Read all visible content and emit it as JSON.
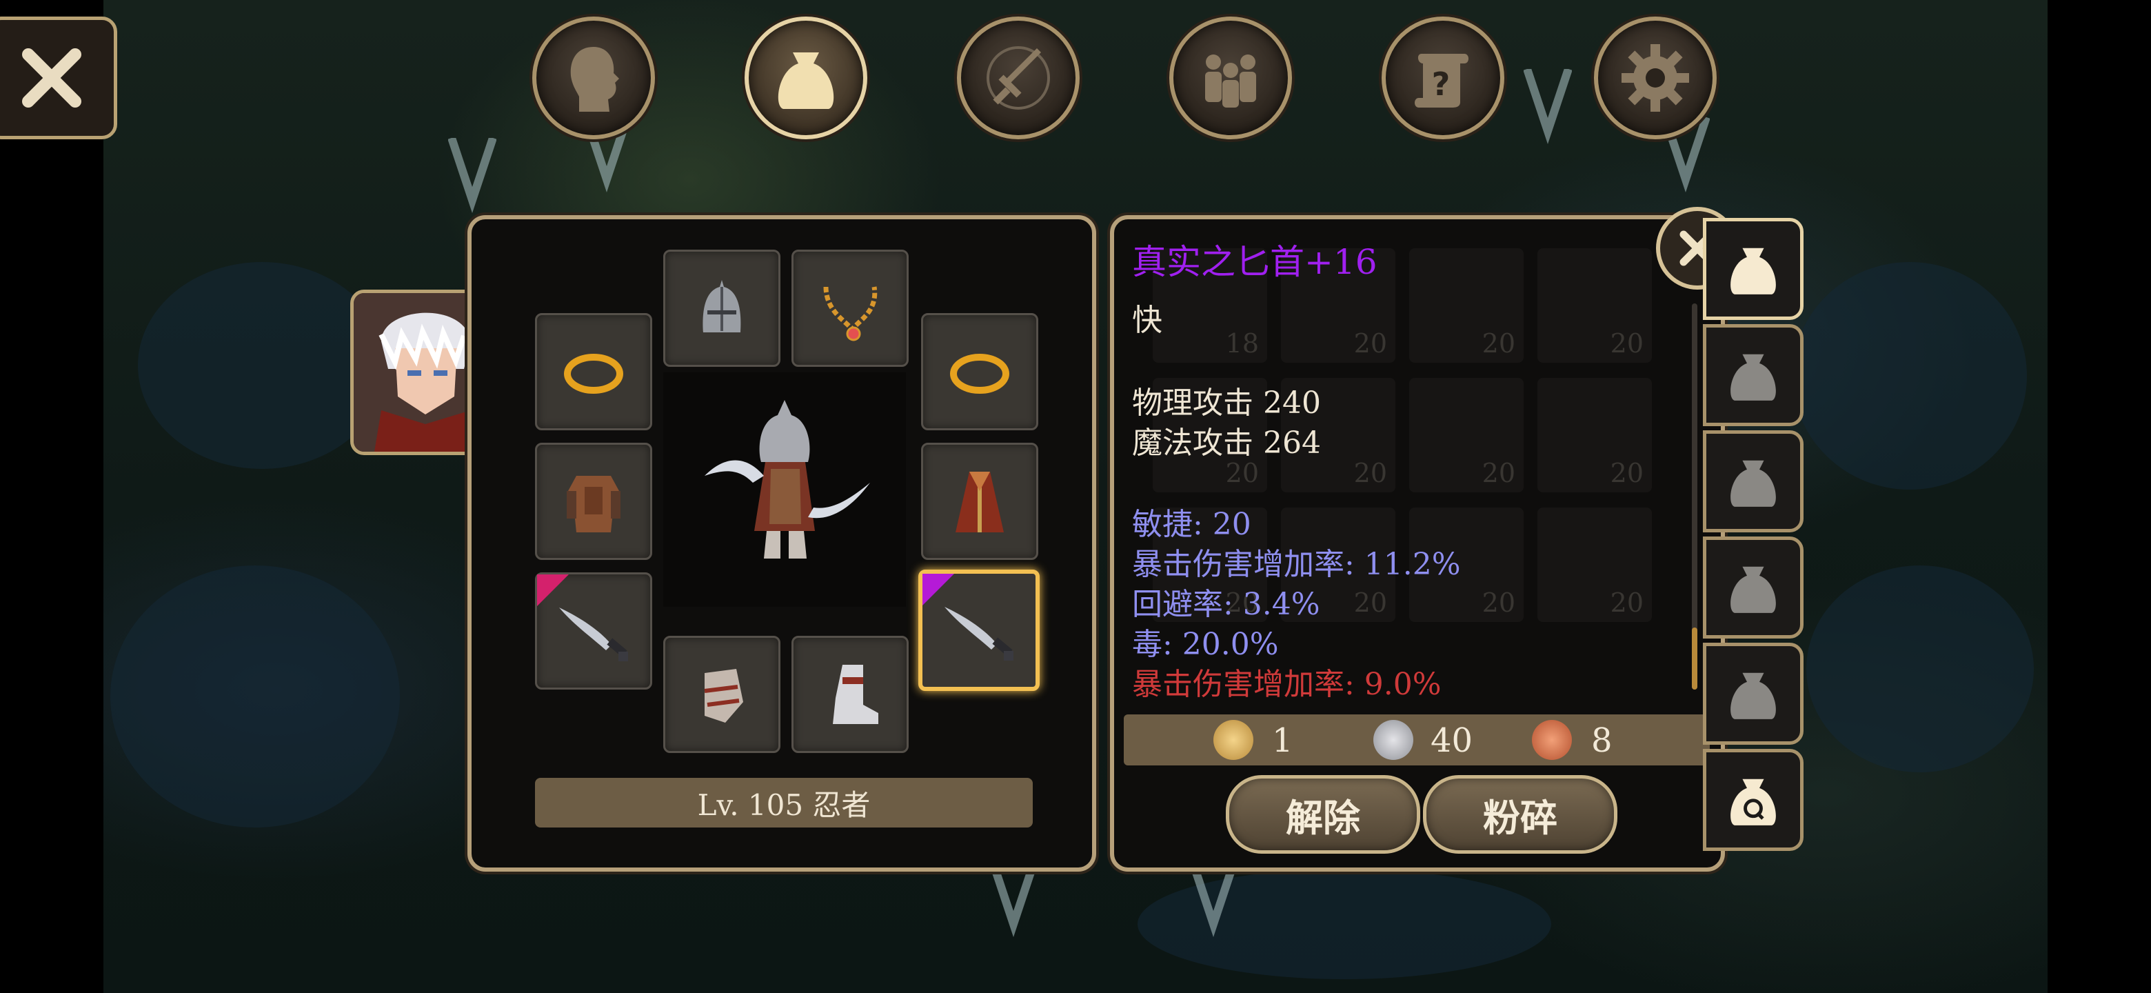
{
  "top_nav": {
    "buttons": [
      {
        "name": "character",
        "icon": "head-icon"
      },
      {
        "name": "inventory",
        "icon": "bag-icon"
      },
      {
        "name": "skills",
        "icon": "sword-icon"
      },
      {
        "name": "party",
        "icon": "people-icon"
      },
      {
        "name": "quests",
        "icon": "scroll-question-icon"
      },
      {
        "name": "settings",
        "icon": "gear-icon"
      }
    ],
    "active": "inventory"
  },
  "equipment": {
    "level_label": "Lv. 105 忍者"
  },
  "item": {
    "name": "真实之匕首+16",
    "name_color": "#a020f0",
    "speed": "快",
    "physical_attack": "物理攻击 240",
    "magic_attack": "魔法攻击 264",
    "stats": [
      {
        "text": "敏捷: 20",
        "color": "#8f8ff0"
      },
      {
        "text": "暴击伤害增加率: 11.2%",
        "color": "#8f8ff0"
      },
      {
        "text": "回避率: 3.4%",
        "color": "#8f8ff0"
      },
      {
        "text": "毒: 20.0%",
        "color": "#8f8ff0"
      },
      {
        "text": "暴击伤害增加率: 9.0%",
        "color": "#d03a3a"
      }
    ]
  },
  "inventory_grid": {
    "counts": [
      "18",
      "20",
      "20",
      "20",
      "20",
      "20",
      "20",
      "20",
      "20",
      "20",
      "20",
      "20"
    ]
  },
  "currency": {
    "gold": "1",
    "silver": "40",
    "copper": "8"
  },
  "actions": {
    "unequip": "解除",
    "smash": "粉碎"
  },
  "colors": {
    "frame": "#b6a07a",
    "bar": "#6d5d45",
    "selected": "#f3c052"
  }
}
